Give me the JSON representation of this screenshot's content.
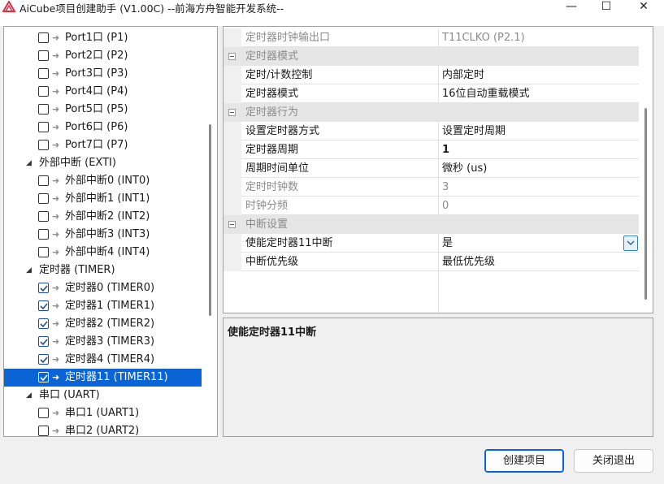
{
  "window": {
    "title": "AiCube项目创建助手 (V1.00C) --前海方舟智能开发系统--",
    "minimize_glyph": "—",
    "maximize_glyph": "☐",
    "close_glyph": "✕"
  },
  "tree": {
    "ports": [
      {
        "label": "Port1口 (P1)",
        "checked": false
      },
      {
        "label": "Port2口 (P2)",
        "checked": false
      },
      {
        "label": "Port3口 (P3)",
        "checked": false
      },
      {
        "label": "Port4口 (P4)",
        "checked": false
      },
      {
        "label": "Port5口 (P5)",
        "checked": false
      },
      {
        "label": "Port6口 (P6)",
        "checked": false
      },
      {
        "label": "Port7口 (P7)",
        "checked": false
      }
    ],
    "exti_group": "外部中断 (EXTI)",
    "exti": [
      {
        "label": "外部中断0 (INT0)",
        "checked": false
      },
      {
        "label": "外部中断1 (INT1)",
        "checked": false
      },
      {
        "label": "外部中断2 (INT2)",
        "checked": false
      },
      {
        "label": "外部中断3 (INT3)",
        "checked": false
      },
      {
        "label": "外部中断4 (INT4)",
        "checked": false
      }
    ],
    "timer_group": "定时器 (TIMER)",
    "timers": [
      {
        "label": "定时器0 (TIMER0)",
        "checked": true
      },
      {
        "label": "定时器1 (TIMER1)",
        "checked": true
      },
      {
        "label": "定时器2 (TIMER2)",
        "checked": true
      },
      {
        "label": "定时器3 (TIMER3)",
        "checked": true
      },
      {
        "label": "定时器4 (TIMER4)",
        "checked": true
      },
      {
        "label": "定时器11 (TIMER11)",
        "checked": true,
        "selected": true
      }
    ],
    "uart_group": "串口 (UART)",
    "uarts": [
      {
        "label": "串口1 (UART1)",
        "checked": false
      },
      {
        "label": "串口2 (UART2)",
        "checked": false
      }
    ]
  },
  "properties": {
    "clock_output": {
      "name": "定时器时钟输出口",
      "value": "T11CLKO (P2.1)"
    },
    "cat_mode": "定时器模式",
    "mode_rows": [
      {
        "name": "定时/计数控制",
        "value": "内部定时"
      },
      {
        "name": "定时器模式",
        "value": "16位自动重载模式"
      }
    ],
    "cat_behavior": "定时器行为",
    "behavior_rows": [
      {
        "name": "设置定时器方式",
        "value": "设置定时周期"
      },
      {
        "name": "定时器周期",
        "value": "1"
      },
      {
        "name": "周期时间单位",
        "value": "微秒 (us)"
      },
      {
        "name": "定时时钟数",
        "value": "3"
      },
      {
        "name": "时钟分频",
        "value": "0"
      }
    ],
    "cat_interrupt": "中断设置",
    "interrupt_rows": [
      {
        "name": "使能定时器11中断",
        "value": "是"
      },
      {
        "name": "中断优先级",
        "value": "最低优先级"
      }
    ]
  },
  "description": {
    "title": "使能定时器11中断"
  },
  "buttons": {
    "create": "创建项目",
    "close": "关闭退出"
  },
  "colors": {
    "selection": "#0a64d6",
    "category_bg": "#e6e6e6",
    "disabled_text": "#8c8c8c",
    "app_icon": "#d9324a"
  }
}
